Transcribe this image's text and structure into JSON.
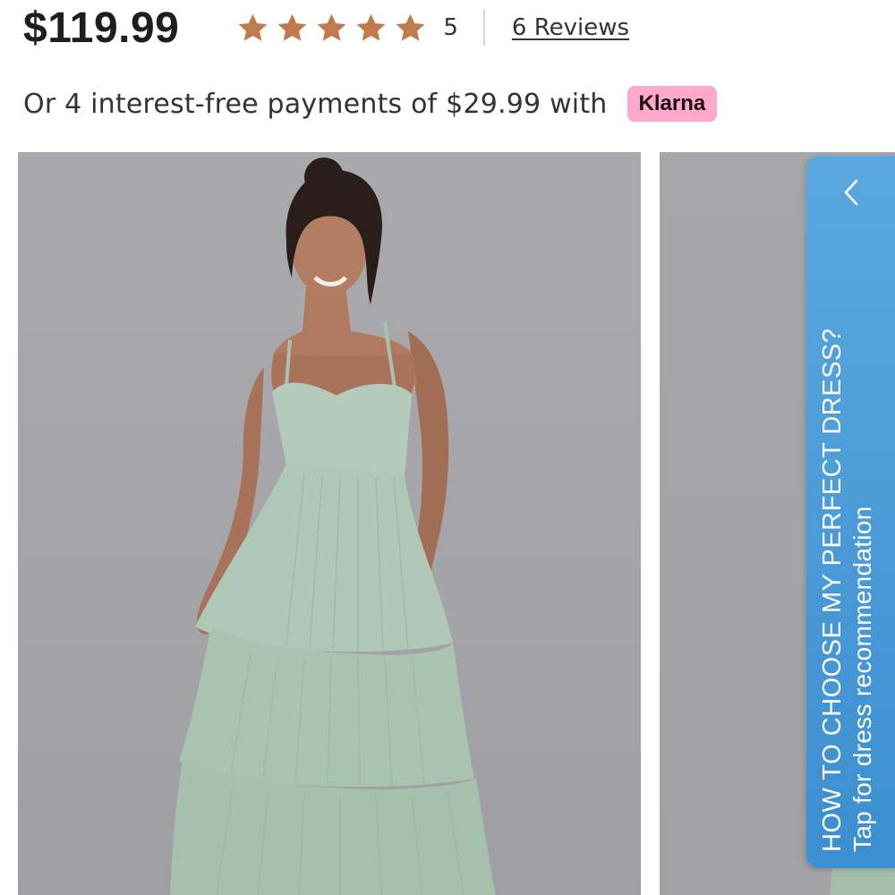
{
  "product": {
    "price": "$119.99",
    "rating": 5,
    "rating_label": "5",
    "reviews_label": "6 Reviews",
    "star_color": "#c07a4e"
  },
  "payment": {
    "text": "Or 4 interest-free payments of $29.99 with",
    "provider_label": "Klarna",
    "provider_color": "#ffa8cd"
  },
  "gallery": {
    "main_image": "model-in-sage-green-tiered-pleated-dress",
    "next_image": "next-product-photo-partial"
  },
  "side_tab": {
    "title": "HOW TO CHOOSE MY PERFECT DRESS?",
    "subtitle": "Tap for dress recommendation",
    "icon": "chevron-left-icon",
    "color": "#4a9bd8"
  }
}
